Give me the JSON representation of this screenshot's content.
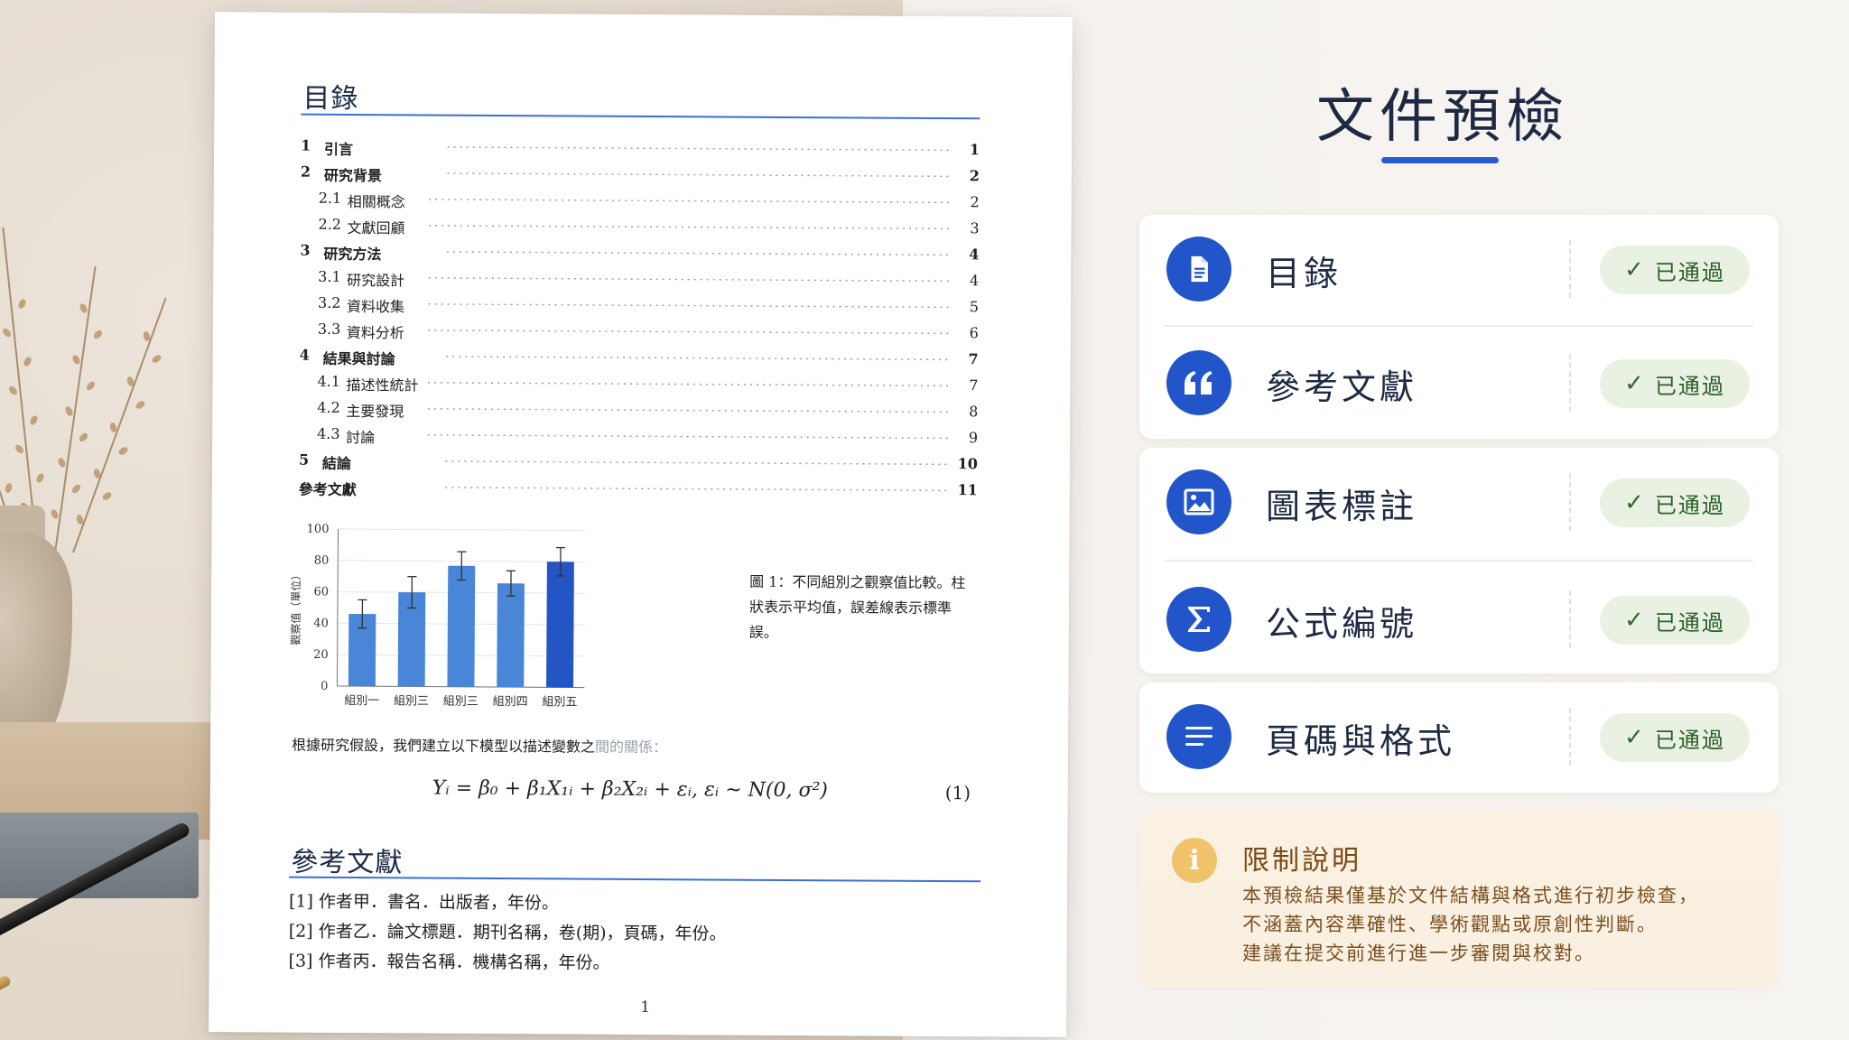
{
  "document": {
    "toc_title": "目錄",
    "toc": [
      {
        "num": "1",
        "label": "引言",
        "page": "1",
        "bold": true,
        "indent": 0
      },
      {
        "num": "2",
        "label": "研究背景",
        "page": "2",
        "bold": true,
        "indent": 0
      },
      {
        "num": "2.1",
        "label": "相關概念",
        "page": "2",
        "bold": false,
        "indent": 1
      },
      {
        "num": "2.2",
        "label": "文獻回顧",
        "page": "3",
        "bold": false,
        "indent": 1
      },
      {
        "num": "3",
        "label": "研究方法",
        "page": "4",
        "bold": true,
        "indent": 0
      },
      {
        "num": "3.1",
        "label": "研究設計",
        "page": "4",
        "bold": false,
        "indent": 1
      },
      {
        "num": "3.2",
        "label": "資料收集",
        "page": "5",
        "bold": false,
        "indent": 1
      },
      {
        "num": "3.3",
        "label": "資料分析",
        "page": "6",
        "bold": false,
        "indent": 1
      },
      {
        "num": "4",
        "label": "結果與討論",
        "page": "7",
        "bold": true,
        "indent": 0
      },
      {
        "num": "4.1",
        "label": "描述性統計",
        "page": "7",
        "bold": false,
        "indent": 1
      },
      {
        "num": "4.2",
        "label": "主要發現",
        "page": "8",
        "bold": false,
        "indent": 1
      },
      {
        "num": "4.3",
        "label": "討論",
        "page": "9",
        "bold": false,
        "indent": 1
      },
      {
        "num": "5",
        "label": "結論",
        "page": "10",
        "bold": true,
        "indent": 0
      },
      {
        "num": "",
        "label": "參考文獻",
        "page": "11",
        "bold": true,
        "indent": 0
      }
    ],
    "figure_caption": "圖 1：不同組別之觀察值比較。柱狀表示平均值，誤差線表示標準誤。",
    "body_text": "根據研究假設，我們建立以下模型以描述變數之",
    "body_text_faded": "間的關係：",
    "formula": "Yᵢ = β₀ + β₁X₁ᵢ + β₂X₂ᵢ + εᵢ,   εᵢ ∼ N(0, σ²)",
    "equation_number": "(1)",
    "references_title": "參考文獻",
    "references": [
      "[1]  作者甲．書名．出版者，年份。",
      "[2]  作者乙．論文標題．期刊名稱，卷(期)，頁碼，年份。",
      "[3]  作者丙．報告名稱．機構名稱，年份。"
    ],
    "page_number": "1"
  },
  "chart_data": {
    "type": "bar",
    "categories": [
      "組別一",
      "組別三",
      "組別三",
      "組別四",
      "組別五"
    ],
    "values": [
      46,
      60,
      77,
      66,
      80
    ],
    "errors": [
      9,
      10,
      9,
      8,
      9
    ],
    "ylabel": "觀察值（單位）",
    "ylim": [
      0,
      100
    ],
    "yticks": [
      0,
      20,
      40,
      60,
      80,
      100
    ],
    "colors": [
      "#4a86d8",
      "#4a86d8",
      "#4a86d8",
      "#4a86d8",
      "#2356c4"
    ],
    "grid": true
  },
  "panel": {
    "title": "文件預檢",
    "checks": [
      {
        "label": "目錄",
        "status": "已通過",
        "icon": "document-icon"
      },
      {
        "label": "參考文獻",
        "status": "已通過",
        "icon": "quote-icon"
      },
      {
        "label": "圖表標註",
        "status": "已通過",
        "icon": "image-icon"
      },
      {
        "label": "公式編號",
        "status": "已通過",
        "icon": "sigma-icon"
      },
      {
        "label": "頁碼與格式",
        "status": "已通過",
        "icon": "lines-icon"
      }
    ],
    "check_mark": "✓",
    "note": {
      "icon_glyph": "i",
      "title": "限制說明",
      "lines": [
        "本預檢結果僅基於文件結構與格式進行初步檢查，",
        "不涵蓋內容準確性、學術觀點或原創性判斷。",
        "建議在提交前進行進一步審閱與校對。"
      ]
    },
    "colors": {
      "accent": "#2255c9",
      "pass_bg": "#e9f1e2",
      "pass_text": "#2b5f2b",
      "note_bg": "#fbf1e3",
      "note_icon": "#f0c36a"
    }
  }
}
